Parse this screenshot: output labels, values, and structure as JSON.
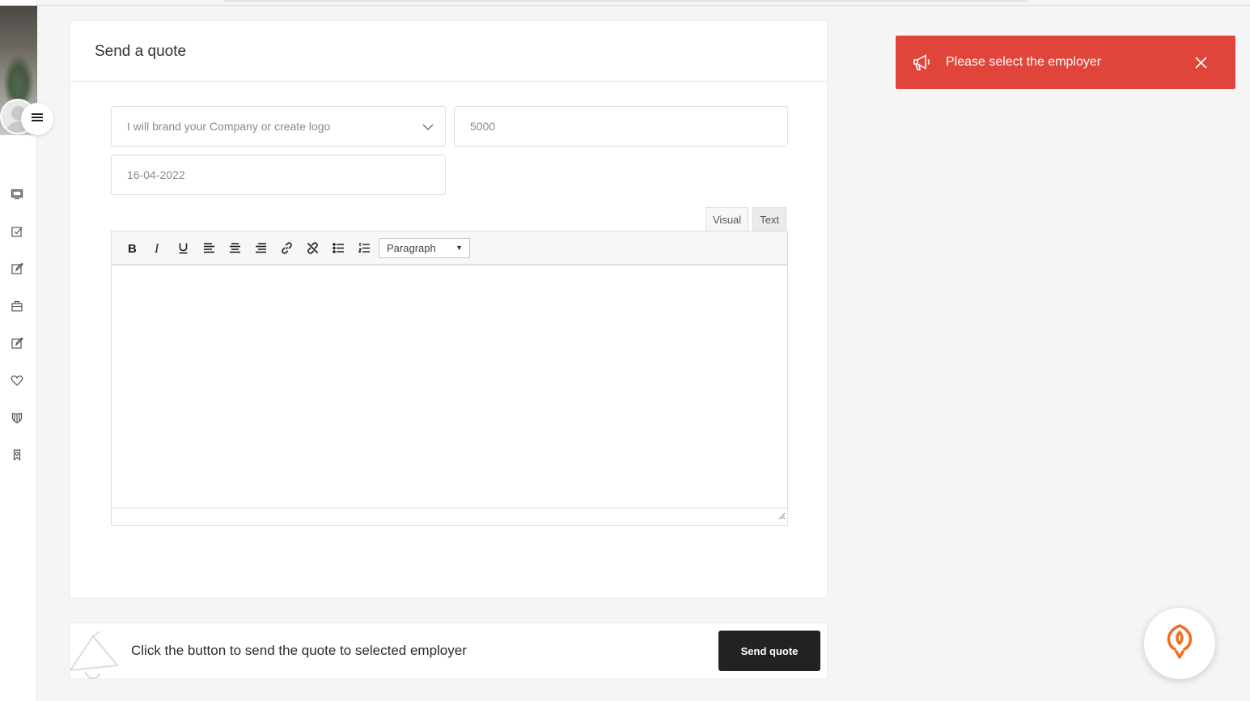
{
  "page": {
    "title": "Send a quote"
  },
  "form": {
    "service_select": {
      "value": "I will brand your Company or create logo"
    },
    "price_input": {
      "value": "5000"
    },
    "date_input": {
      "value": "16-04-2022"
    }
  },
  "editor": {
    "tabs": [
      {
        "label": "Visual",
        "active": true
      },
      {
        "label": "Text",
        "active": false
      }
    ],
    "toolbar": {
      "format_select": "Paragraph",
      "buttons": [
        "bold-icon",
        "italic-icon",
        "underline-icon",
        "align-left-icon",
        "align-center-icon",
        "align-right-icon",
        "link-icon",
        "unlink-icon",
        "bullet-list-icon",
        "numbered-list-icon"
      ]
    },
    "content": ""
  },
  "footer": {
    "text": "Click the button to send the quote to selected employer",
    "send_button": "Send quote"
  },
  "toast": {
    "message": "Please select the employer",
    "icon": "megaphone-icon",
    "color": "#e0443a"
  },
  "sidebar": {
    "icons": [
      "monitor-icon",
      "checkbox-icon",
      "edit-icon",
      "briefcase-icon",
      "edit-icon",
      "heart-icon",
      "shield-icon",
      "bookmark-icon"
    ]
  },
  "colors": {
    "primary_button": "#222222",
    "toast": "#e0443a",
    "help_accent": "#f26c21"
  }
}
